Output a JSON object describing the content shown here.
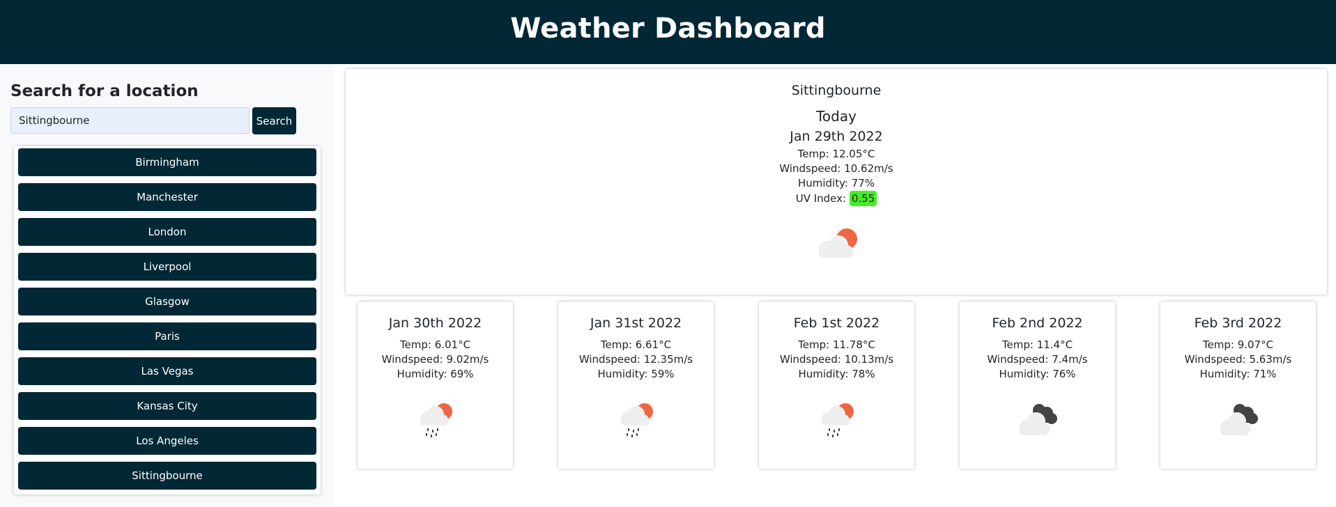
{
  "header": {
    "title": "Weather Dashboard"
  },
  "search": {
    "title": "Search for a location",
    "value": "Sittingbourne",
    "button_label": "Search"
  },
  "cities": [
    "Birmingham",
    "Manchester",
    "London",
    "Liverpool",
    "Glasgow",
    "Paris",
    "Las Vegas",
    "Kansas City",
    "Los Angeles",
    "Sittingbourne"
  ],
  "today": {
    "city": "Sittingbourne",
    "label": "Today",
    "date": "Jan 29th 2022",
    "temp": "Temp: 12.05°C",
    "wind": "Windspeed: 10.62m/s",
    "humidity": "Humidity: 77%",
    "uv_label": "UV Index:",
    "uv_value": "0.55",
    "uv_color": "#44ee22",
    "icon": "partly-cloudy-day-icon"
  },
  "forecast": [
    {
      "date": "Jan 30th 2022",
      "temp": "Temp: 6.01°C",
      "wind": "Windspeed: 9.02m/s",
      "humidity": "Humidity: 69%",
      "icon": "rain-sun-icon"
    },
    {
      "date": "Jan 31st 2022",
      "temp": "Temp: 6.61°C",
      "wind": "Windspeed: 12.35m/s",
      "humidity": "Humidity: 59%",
      "icon": "rain-sun-icon"
    },
    {
      "date": "Feb 1st 2022",
      "temp": "Temp: 11.78°C",
      "wind": "Windspeed: 10.13m/s",
      "humidity": "Humidity: 78%",
      "icon": "rain-sun-icon"
    },
    {
      "date": "Feb 2nd 2022",
      "temp": "Temp: 11.4°C",
      "wind": "Windspeed: 7.4m/s",
      "humidity": "Humidity: 76%",
      "icon": "broken-clouds-icon"
    },
    {
      "date": "Feb 3rd 2022",
      "temp": "Temp: 9.07°C",
      "wind": "Windspeed: 5.63m/s",
      "humidity": "Humidity: 71%",
      "icon": "broken-clouds-icon"
    }
  ],
  "colors": {
    "primary": "#022836",
    "sun": "#ee6644",
    "cloud_light": "#eeeeee",
    "cloud_dark": "#444444"
  }
}
